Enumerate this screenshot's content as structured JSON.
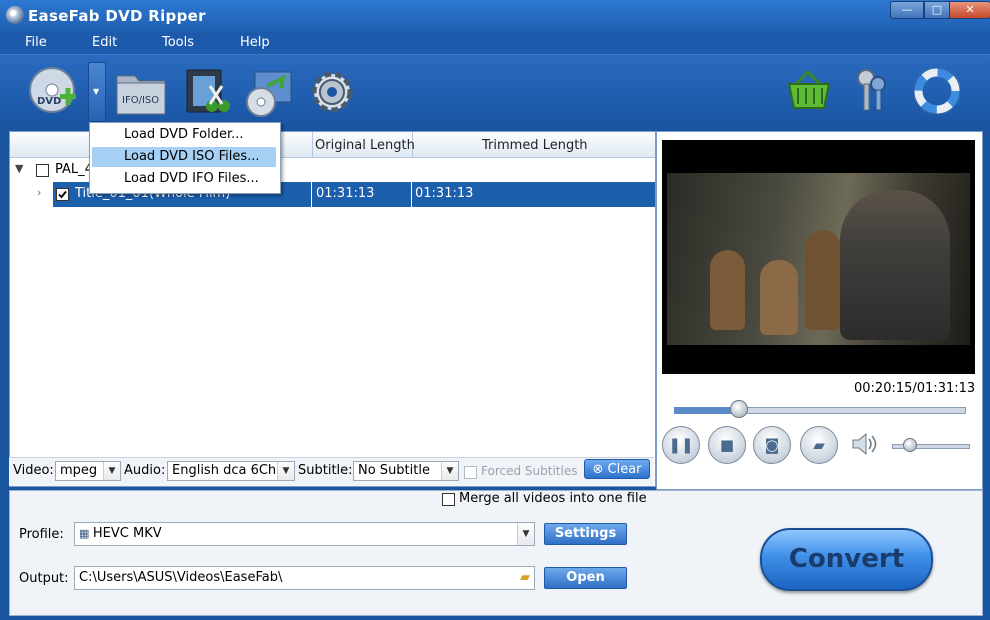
{
  "app": {
    "title": "EaseFab DVD Ripper"
  },
  "window_controls": {
    "minimize": "—",
    "maximize": "□",
    "close": "✕"
  },
  "menu": [
    "File",
    "Edit",
    "Tools",
    "Help"
  ],
  "toolbar": {
    "icons": [
      "dvd-add-icon",
      "ifo-iso-icon",
      "video-edit-icon",
      "dvd-export-icon",
      "settings-gear-icon",
      "basket-icon",
      "keys-icon",
      "lifebuoy-icon"
    ],
    "ifo_iso_label": "IFO/ISO"
  },
  "dropdown_menu": [
    "Load DVD Folder...",
    "Load DVD ISO Files...",
    "Load DVD IFO Files..."
  ],
  "file_list": {
    "columns": [
      "Original Length",
      "Trimmed Length"
    ],
    "group": {
      "label": "PAL_4"
    },
    "rows": [
      {
        "title": "Title_01_01(Whole Film)",
        "original": "01:31:13",
        "trimmed": "01:31:13"
      }
    ]
  },
  "options": {
    "video_label": "Video:",
    "video_value": "mpeg",
    "audio_label": "Audio:",
    "audio_value": "English dca 6Ch",
    "subtitle_label": "Subtitle:",
    "subtitle_value": "No Subtitle",
    "forced_subtitles": "Forced Subtitles",
    "clear": "Clear"
  },
  "player": {
    "time": "00:20:15/01:31:13",
    "seek_fraction": 0.22,
    "volume_fraction": 0.22
  },
  "merge_label": "Merge all videos into one file",
  "profile": {
    "label": "Profile:",
    "value": "HEVC MKV",
    "settings": "Settings"
  },
  "output": {
    "label": "Output:",
    "value": "C:\\Users\\ASUS\\Videos\\EaseFab\\",
    "open": "Open"
  },
  "convert": "Convert",
  "colors": {
    "accent": "#1b5fad",
    "title_bar": "#2d78d0",
    "highlight": "#a7d1f4"
  }
}
